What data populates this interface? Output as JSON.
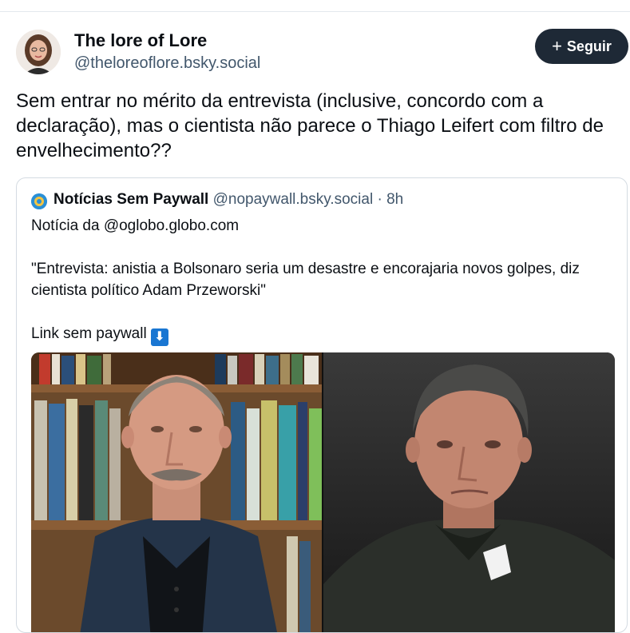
{
  "post": {
    "author_name": "The lore of Lore",
    "author_handle": "@theloreoflore.bsky.social",
    "follow_label": "Seguir",
    "follow_icon": "plus-icon",
    "text": "Sem entrar no mérito da entrevista (inclusive, concordo com a declaração), mas o cientista não parece o Thiago Leifert com filtro de envelhecimento??"
  },
  "quote": {
    "author_name": "Notícias Sem Paywall",
    "author_handle": "@nopaywall.bsky.social",
    "separator": "·",
    "time": "8h",
    "line1": "Notícia da @oglobo.globo.com",
    "line2": "\"Entrevista: anistia a Bolsonaro seria um desastre e encorajaria novos golpes, diz cientista político Adam Przeworski\"",
    "line3": "Link sem paywall",
    "line3_emoji": "⬇",
    "media": {
      "left_image": "photo of older man in front of bookshelf",
      "right_image": "photo of man in dark polo shirt"
    }
  },
  "colors": {
    "follow_bg": "#1e2936",
    "text_primary": "#0b0f14",
    "text_secondary": "#42576c",
    "border": "#d4dbe2"
  }
}
